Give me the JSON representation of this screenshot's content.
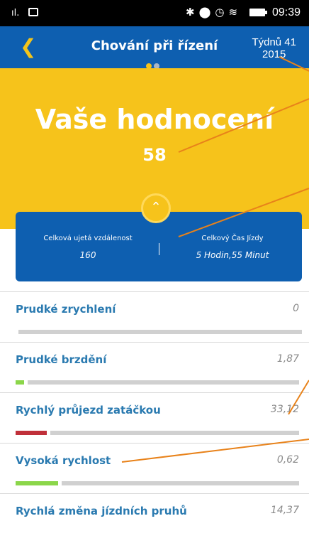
{
  "status_bar": {
    "time": "09:39"
  },
  "header": {
    "title": "Chování při řízení",
    "week_line1": "Týdnů 41",
    "week_line2": "2015",
    "active_dot_color": "#f6c31b",
    "inactive_dot_color": "#aab6c4"
  },
  "hero": {
    "label": "Vaše hodnocení",
    "score": "58"
  },
  "stats": {
    "distance_label": "Celková ujetá vzdálenost",
    "distance_value": "160",
    "time_label": "Celkový Čas Jízdy",
    "time_value": "5 Hodin,55 Minut"
  },
  "metrics": [
    {
      "name": "Prudké zrychlení",
      "value": "0",
      "level": 0.0,
      "color": "#8bd64a"
    },
    {
      "name": "Prudké brzdění",
      "value": "1,87",
      "level": 0.03,
      "color": "#8bd64a"
    },
    {
      "name": "Rychlý průjezd zatáčkou",
      "value": "33,12",
      "level": 0.11,
      "color": "#c0303a"
    },
    {
      "name": "Vysoká rychlost",
      "value": "0,62",
      "level": 0.15,
      "color": "#8bd64a"
    },
    {
      "name": "Rychlá změna jízdních pruhů",
      "value": "14,37",
      "level": null,
      "color": "#8bd64a"
    }
  ],
  "annotation_line_color": "#e8821a"
}
